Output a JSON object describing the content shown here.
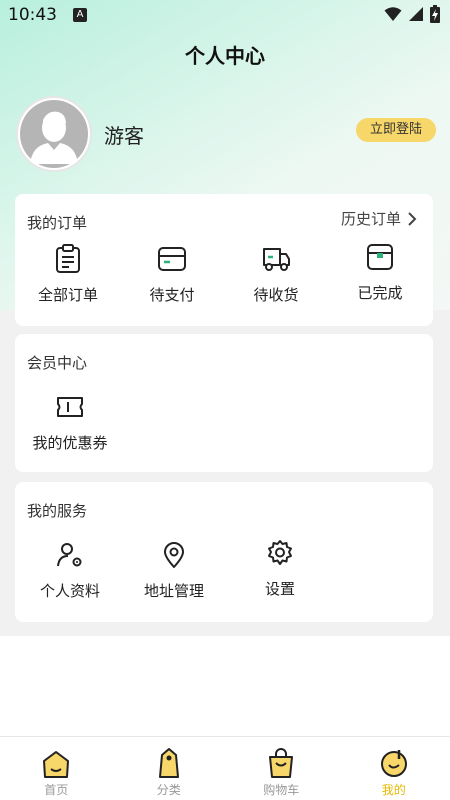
{
  "status": {
    "time": "10:43",
    "indicator": "A"
  },
  "header": {
    "title": "个人中心"
  },
  "profile": {
    "name": "游客",
    "login_label": "立即登陆"
  },
  "orders": {
    "title": "我的订单",
    "history_label": "历史订单",
    "items": [
      {
        "label": "全部订单",
        "icon": "clipboard-icon"
      },
      {
        "label": "待支付",
        "icon": "card-icon"
      },
      {
        "label": "待收货",
        "icon": "truck-icon"
      },
      {
        "label": "已完成",
        "icon": "box-icon"
      }
    ]
  },
  "member": {
    "title": "会员中心",
    "items": [
      {
        "label": "我的优惠券",
        "icon": "ticket-icon"
      }
    ]
  },
  "services": {
    "title": "我的服务",
    "items": [
      {
        "label": "个人资料",
        "icon": "user-gear-icon"
      },
      {
        "label": "地址管理",
        "icon": "location-pin-icon"
      },
      {
        "label": "设置",
        "icon": "gear-icon"
      }
    ]
  },
  "tabbar": {
    "items": [
      {
        "label": "首页",
        "icon": "home-icon",
        "active": false
      },
      {
        "label": "分类",
        "icon": "tag-icon",
        "active": false
      },
      {
        "label": "购物车",
        "icon": "shopping-bag-icon",
        "active": false
      },
      {
        "label": "我的",
        "icon": "profile-icon",
        "active": true
      }
    ],
    "active_color": "#e6b800",
    "inactive_color": "#999999"
  },
  "colors": {
    "accent": "#f7d66a",
    "header_gradient": "#b8efdd",
    "page_bg": "#f1f1f1"
  }
}
